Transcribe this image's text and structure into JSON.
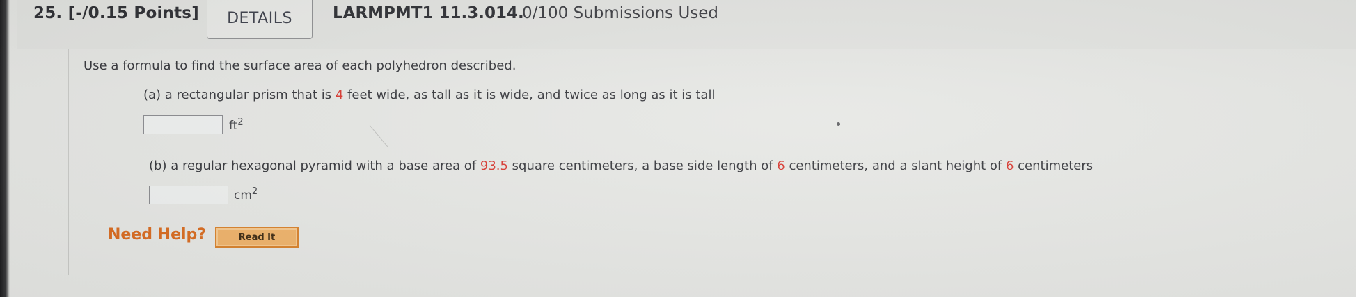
{
  "header": {
    "question_number": "25.",
    "points": "[-/0.15 Points]",
    "details_label": "DETAILS",
    "problem_id": "LARMPMT1 11.3.014.",
    "submissions": "0/100 Submissions Used"
  },
  "question": {
    "intro": "Use a formula to find the surface area of each polyhedron described.",
    "part_a": {
      "text_1": "(a) a rectangular prism that is ",
      "value_1": "4",
      "text_2": " feet wide, as tall as it is wide, and twice as long as it is tall",
      "answer_value": "",
      "unit_base": "ft",
      "unit_exp": "2"
    },
    "part_b": {
      "text_1": "(b) a regular hexagonal pyramid with a base area of ",
      "value_1": "93.5",
      "text_2": " square centimeters, a base side length of ",
      "value_2": "6",
      "text_3": " centimeters, and a slant height of ",
      "value_3": "6",
      "text_4": " centimeters",
      "answer_value": "",
      "unit_base": "cm",
      "unit_exp": "2"
    }
  },
  "help": {
    "need_help_label": "Need Help?",
    "read_it_label": "Read It"
  },
  "colors": {
    "highlight_red": "#d8352d",
    "need_help_orange": "#d96b1f",
    "button_orange": "#f0b36a"
  }
}
